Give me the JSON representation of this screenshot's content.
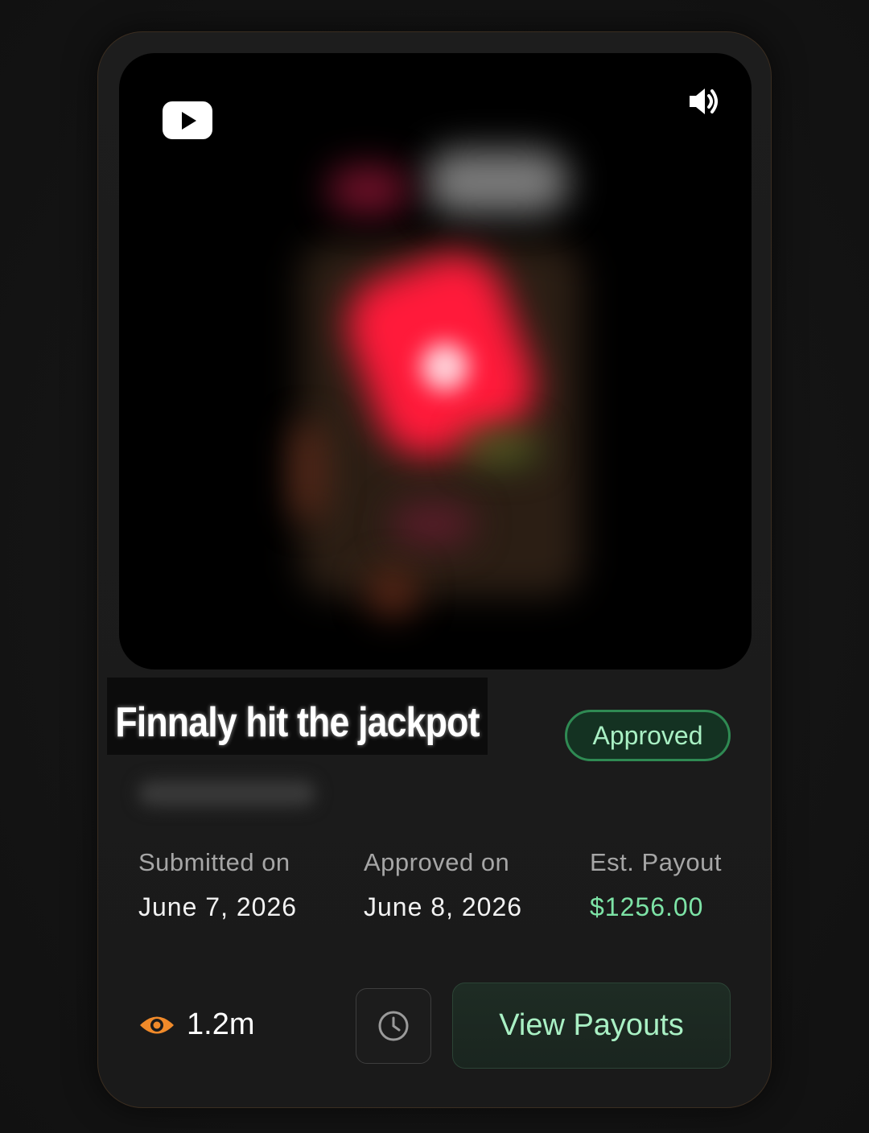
{
  "video": {
    "platform_icon": "youtube-icon",
    "audio_icon": "volume-icon"
  },
  "card": {
    "title": "Finnaly hit the jackpot",
    "status": "Approved",
    "status_color": "#2f8a53"
  },
  "stats": [
    {
      "label": "Submitted on",
      "value": "June 7, 2026"
    },
    {
      "label": "Approved on",
      "value": "June 8, 2026"
    },
    {
      "label": "Est. Payout",
      "value": "$1256.00"
    }
  ],
  "footer": {
    "views_icon": "eye-icon",
    "views": "1.2m",
    "history_icon": "clock-icon",
    "button_label": "View Payouts"
  },
  "colors": {
    "accent_green": "#7de3a6",
    "eye_orange": "#f08a2a"
  }
}
